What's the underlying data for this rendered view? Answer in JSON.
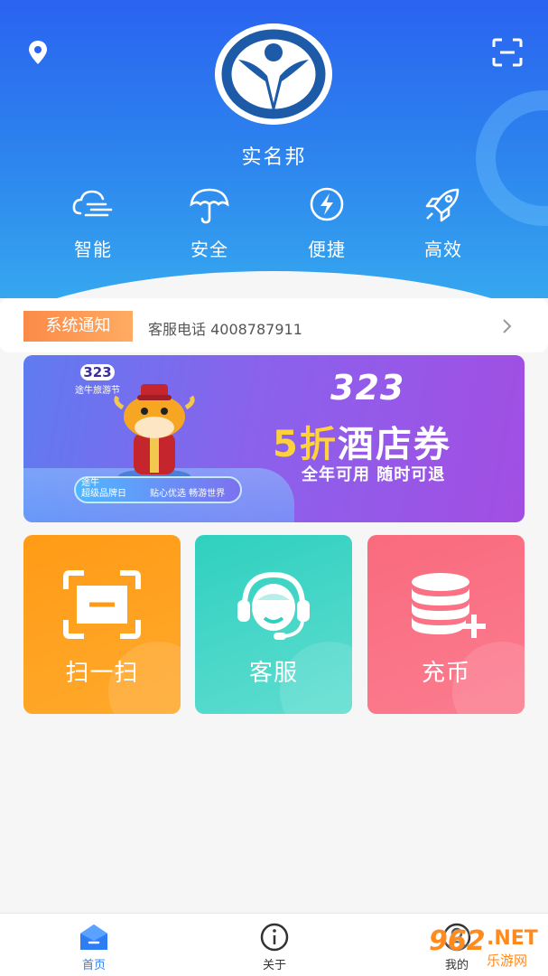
{
  "header": {
    "app_name": "实名邦",
    "location_icon": "location-pin-icon",
    "scan_icon": "scan-frame-icon"
  },
  "features": [
    {
      "label": "智能",
      "icon": "cloud-speed-icon"
    },
    {
      "label": "安全",
      "icon": "umbrella-icon"
    },
    {
      "label": "便捷",
      "icon": "lightning-circle-icon"
    },
    {
      "label": "高效",
      "icon": "rocket-icon"
    }
  ],
  "notice": {
    "tag": "系统通知",
    "text": "客服电话 4008787911"
  },
  "banner": {
    "event_logo_number": "323",
    "event_logo_text": "途牛旅游节",
    "number": "323",
    "headline_highlight": "5折",
    "headline_rest": "酒店券",
    "subline": "全年可用 随时可退",
    "pill_brand_top": "途牛",
    "pill_brand": "超级品牌日",
    "pill_slogan": "贴心优选  畅游世界"
  },
  "tiles": [
    {
      "label": "扫一扫",
      "icon": "scan-icon",
      "color": "#ff9b16"
    },
    {
      "label": "客服",
      "icon": "headset-agent-icon",
      "color": "#2fd0bf"
    },
    {
      "label": "充币",
      "icon": "coin-stack-add-icon",
      "color": "#fa6a7e"
    }
  ],
  "tabbar": {
    "active_color": "#2d7ef3",
    "items": [
      {
        "label": "首页",
        "icon": "home-icon",
        "active": true
      },
      {
        "label": "关于",
        "icon": "info-icon",
        "active": false
      },
      {
        "label": "我的",
        "icon": "user-icon",
        "active": false
      }
    ]
  },
  "watermark": {
    "number": "962",
    "domain": ".NET",
    "site": "乐游网"
  }
}
